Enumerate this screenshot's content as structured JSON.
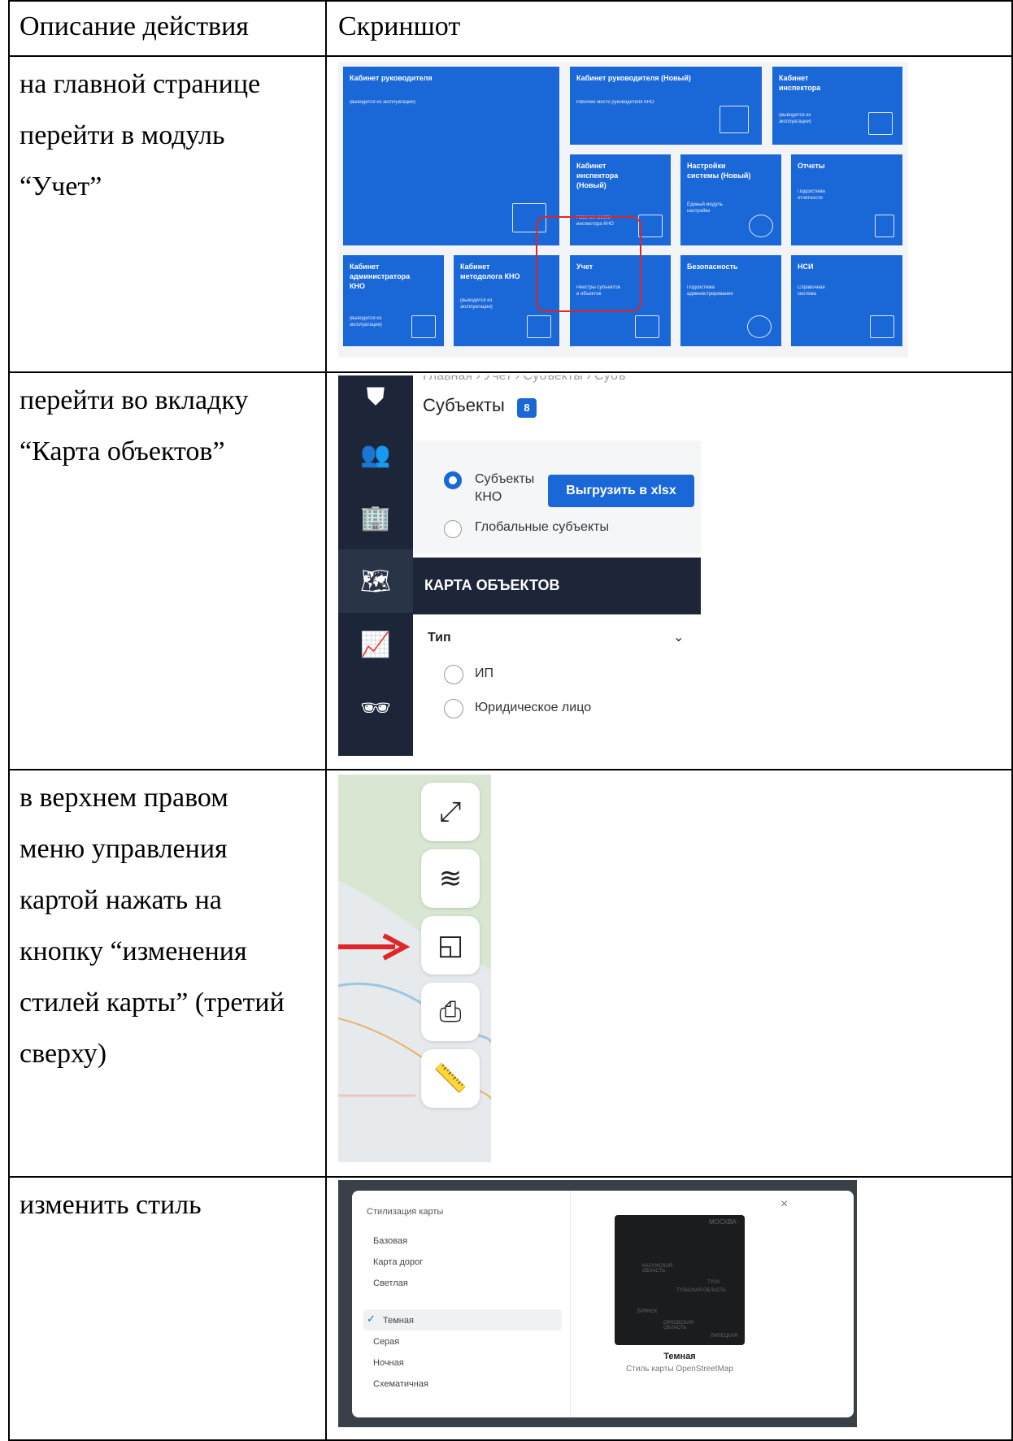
{
  "table": {
    "header": {
      "col1": "Описание действия",
      "col2": "Скриншот"
    },
    "rows": [
      {
        "text": "на главной странице\nперейти в модуль\n“Учет”"
      },
      {
        "text": "перейти во вкладку\n“Карта объектов”"
      },
      {
        "text": "в верхнем правом\nменю управления\nкартой нажать на\nкнопку “изменения\nстилей карты” (третий\nсверху)"
      },
      {
        "text": "изменить стиль"
      }
    ]
  },
  "shot1": {
    "tiles": [
      {
        "title": "Кабинет руководителя",
        "sub": "(выводится из эксплуатации)"
      },
      {
        "title": "Кабинет руководителя (Новый)",
        "sub": "Рабочее место руководителя КНО"
      },
      {
        "title": "Кабинет\nинспектора",
        "sub": "(выводится из\nэксплуатации)"
      },
      {
        "title": "Кабинет\nинспектора\n(Новый)",
        "sub": "Рабочее место\nинспектора КНО"
      },
      {
        "title": "Настройки\nсистемы (Новый)",
        "sub": "Единый модуль\nнастройки"
      },
      {
        "title": "Отчеты",
        "sub": "Подсистема\nотчетности"
      },
      {
        "title": "Кабинет\nадминистратора\nКНО",
        "sub": "(выводится из\nэксплуатации)"
      },
      {
        "title": "Кабинет\nметодолога КНО",
        "sub": "(выводится из\nэксплуатации)"
      },
      {
        "title": "Учет",
        "sub": "Реестры субъектов\nи объектов"
      },
      {
        "title": "Безопасность",
        "sub": "Подсистема\nадминистрирования"
      },
      {
        "title": "НСИ",
        "sub": "Справочная\nсистема"
      }
    ],
    "accent": "#1a67d8"
  },
  "shot2": {
    "breadcrumb": "Главная  ›  Учет  ›  Субъекты  ›  Субъ",
    "title": "Субъекты",
    "badge": "8",
    "radio1": "Субъекты\nКНО",
    "export_button": "Выгрузить в xlsx",
    "radio2": "Глобальные субъекты",
    "tab": "КАРТА ОБЪЕКТОВ",
    "filter_label": "Тип",
    "option1": "ИП",
    "option2": "Юридическое лицо"
  },
  "shot4": {
    "dialog_title": "Стилизация карты",
    "options": [
      "Базовая",
      "Карта дорог",
      "Светлая",
      "Темная",
      "Серая",
      "Ночная",
      "Схематичная"
    ],
    "selected": "Темная",
    "preview_title": "Темная",
    "preview_sub": "Стиль карты OpenStreetMap",
    "map_labels": [
      "МОСКВА",
      "КАЛУЖСКАЯ\nОБЛАСТЬ",
      "ТУЛА",
      "ТУЛЬСКАЯ ОБЛАСТЬ",
      "БРЯНСК",
      "ОРЛОВСКАЯ\nОБЛАСТЬ",
      "ЛИПЕЦКАЯ"
    ]
  }
}
